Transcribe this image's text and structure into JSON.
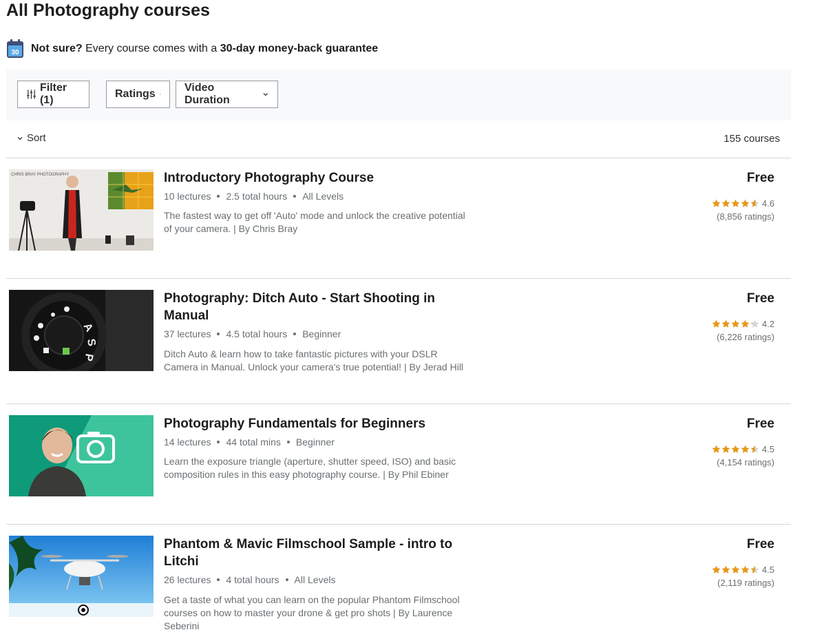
{
  "header": {
    "title": "All Photography courses",
    "guarantee_icon_text": "30",
    "guarantee_bold1": "Not sure?",
    "guarantee_mid": " Every course comes with a ",
    "guarantee_bold2": "30-day money-back guarantee"
  },
  "filters": {
    "filter_label": "Filter (1)",
    "ratings_label": "Ratings",
    "duration_label": "Video Duration"
  },
  "sort": {
    "label": "Sort",
    "count": "155 courses"
  },
  "colors": {
    "star": "#e59819",
    "star_empty": "#d1d7dc",
    "bar_bg": "#f7f9fa",
    "muted": "#6a6f73"
  },
  "courses": [
    {
      "title": "Introductory Photography Course",
      "lectures": "10 lectures",
      "hours": "2.5 total hours",
      "level": "All Levels",
      "desc": "The fastest way to get off 'Auto' mode and unlock the creative potential of your camera. | By Chris Bray",
      "thumb_brand": "CHRIS BRAY PHOTOGRAPHY",
      "price": "Free",
      "rating": 4.6,
      "rating_text": "4.6",
      "ratings_count": "(8,856 ratings)"
    },
    {
      "title": "Photography: Ditch Auto - Start Shooting in Manual",
      "lectures": "37 lectures",
      "hours": "4.5 total hours",
      "level": "Beginner",
      "desc": "Ditch Auto & learn how to take fantastic pictures with your DSLR Camera in Manual. Unlock your camera's true potential! | By Jerad Hill",
      "price": "Free",
      "rating": 4.2,
      "rating_text": "4.2",
      "ratings_count": "(6,226 ratings)"
    },
    {
      "title": "Photography Fundamentals for Beginners",
      "lectures": "14 lectures",
      "hours": "44 total mins",
      "level": "Beginner",
      "desc": "Learn the exposure triangle (aperture, shutter speed, ISO) and basic composition rules in this easy photography course. | By Phil Ebiner",
      "price": "Free",
      "rating": 4.5,
      "rating_text": "4.5",
      "ratings_count": "(4,154 ratings)"
    },
    {
      "title": "Phantom & Mavic Filmschool Sample - intro to Litchi",
      "lectures": "26 lectures",
      "hours": "4 total hours",
      "level": "All Levels",
      "desc": "Get a taste of what you can learn on the popular Phantom Filmschool courses on how to master your drone & get pro shots | By Laurence Seberini",
      "price": "Free",
      "rating": 4.5,
      "rating_text": "4.5",
      "ratings_count": "(2,119 ratings)"
    }
  ]
}
